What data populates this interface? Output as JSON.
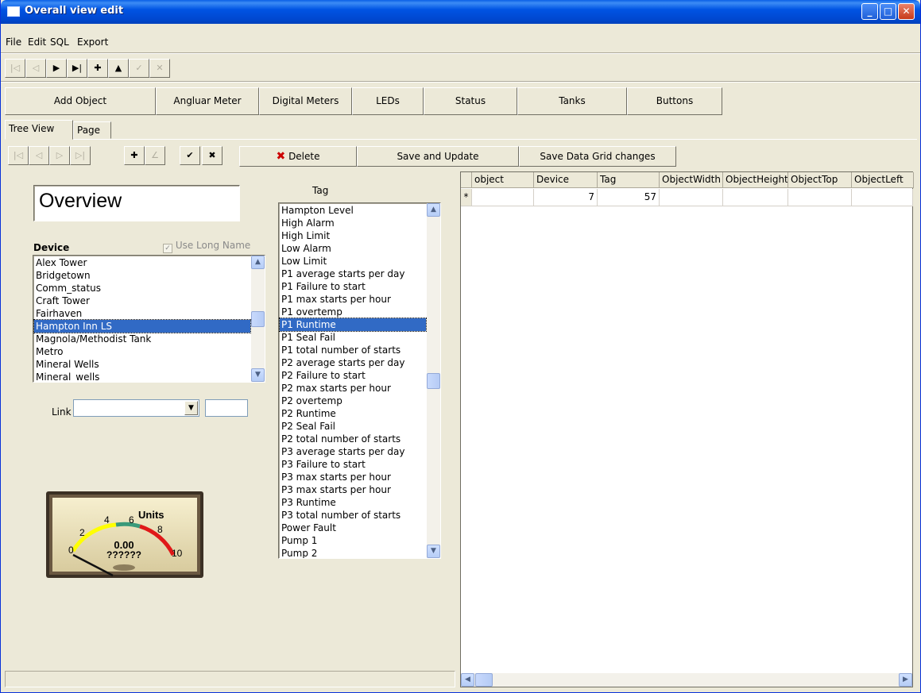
{
  "window": {
    "title": "Overall view edit",
    "min_btn": "_",
    "max_btn": "□",
    "close_btn": "✕"
  },
  "menu": [
    "File",
    "Edit",
    "SQL",
    "Export"
  ],
  "nav_buttons": {
    "first": "|◁",
    "prev": "◁",
    "next": "▶",
    "last": "▶|",
    "add": "✚",
    "up": "▲",
    "post": "✓",
    "cancel": "✕"
  },
  "object_buttons": [
    "Add Object",
    "Angluar Meter",
    "Digital Meters",
    "LEDs",
    "Status",
    "Tanks",
    "Buttons"
  ],
  "tabs": [
    "Tree View",
    "Page"
  ],
  "sub_nav": {
    "first": "|◁",
    "prev": "◁",
    "next": "▷",
    "last": "▷|",
    "add": "✚",
    "edit": "∠",
    "post": "✔",
    "cancel": "✖"
  },
  "actions": {
    "delete_icon": "✖",
    "delete": "Delete",
    "save_update": "Save and Update",
    "save_grid": "Save Data Grid changes"
  },
  "overview_field": "Overview",
  "device": {
    "label": "Device",
    "use_long_name": "Use Long Name",
    "items": [
      "Alex Tower",
      "Bridgetown",
      "Comm_status",
      "Craft Tower",
      "Fairhaven",
      "Hampton Inn LS",
      "Magnola/Methodist Tank",
      "Metro",
      "Mineral Wells",
      "Mineral_wells"
    ],
    "selected": "Hampton Inn LS"
  },
  "link": {
    "label": "Link",
    "value": "",
    "extra": ""
  },
  "meter": {
    "units": "Units",
    "value": "0.00",
    "name": "??????",
    "ticks": [
      "0",
      "2",
      "4",
      "6",
      "8",
      "10"
    ],
    "needle_value": 0,
    "range": [
      0,
      10
    ]
  },
  "tag": {
    "label": "Tag",
    "items": [
      "Hampton Level",
      "High Alarm",
      "High Limit",
      "Low Alarm",
      "Low Limit",
      "P1 average starts per day",
      "P1 Failure to start",
      "P1 max starts per hour",
      "P1 overtemp",
      "P1 Runtime",
      "P1 Seal Fail",
      "P1 total number of starts",
      "P2 average starts per day",
      "P2 Failure to start",
      "P2 max starts per hour",
      "P2 overtemp",
      "P2 Runtime",
      "P2 Seal Fail",
      "P2 total number of starts",
      "P3 average starts per day",
      "P3 Failure to start",
      "P3 max starts per hour",
      "P3 max starts per hour",
      "P3 Runtime",
      "P3 total number of starts",
      "Power Fault",
      "Pump 1",
      "Pump 2"
    ],
    "selected": "P1 Runtime"
  },
  "grid": {
    "columns": [
      "object",
      "Device",
      "Tag",
      "ObjectWidth",
      "ObjectHeight",
      "ObjectTop",
      "ObjectLeft"
    ],
    "new_row_marker": "*",
    "row": [
      "",
      "7",
      "57",
      "",
      "",
      "",
      ""
    ]
  },
  "status_text": ""
}
